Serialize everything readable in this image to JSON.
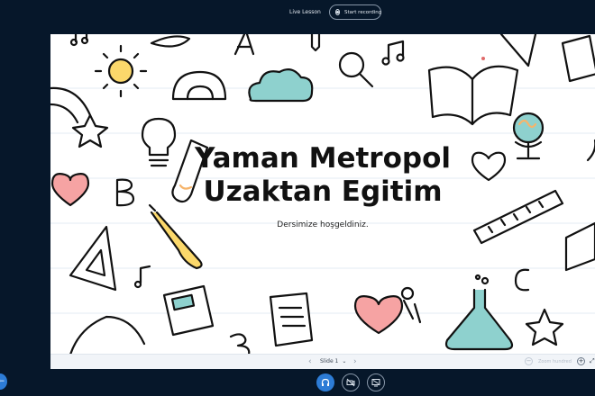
{
  "header": {
    "meeting_title": "Live Lesson",
    "record_button_label": "Start recording"
  },
  "slide": {
    "title_line1": "Yaman Metropol",
    "title_line2": "Uzaktan Egitim",
    "subtitle": "Dersimize hoşgeldiniz."
  },
  "slide_toolbar": {
    "prev_symbol": "‹",
    "current_slide": "Slide 1",
    "dropdown_symbol": "⌄",
    "next_symbol": "›",
    "zoom_out_symbol": "−",
    "zoom_label": "Zoom hundred",
    "zoom_in_symbol": "+",
    "fit_symbol": "⤢"
  },
  "sidebar_toggle_symbol": "←",
  "colors": {
    "background": "#06172a",
    "accent": "#2d7cd6",
    "doodle_teal": "#8ed1ce",
    "doodle_pink": "#f6a3a3",
    "doodle_yellow": "#fbd86b",
    "doodle_orange": "#f6b46b"
  }
}
